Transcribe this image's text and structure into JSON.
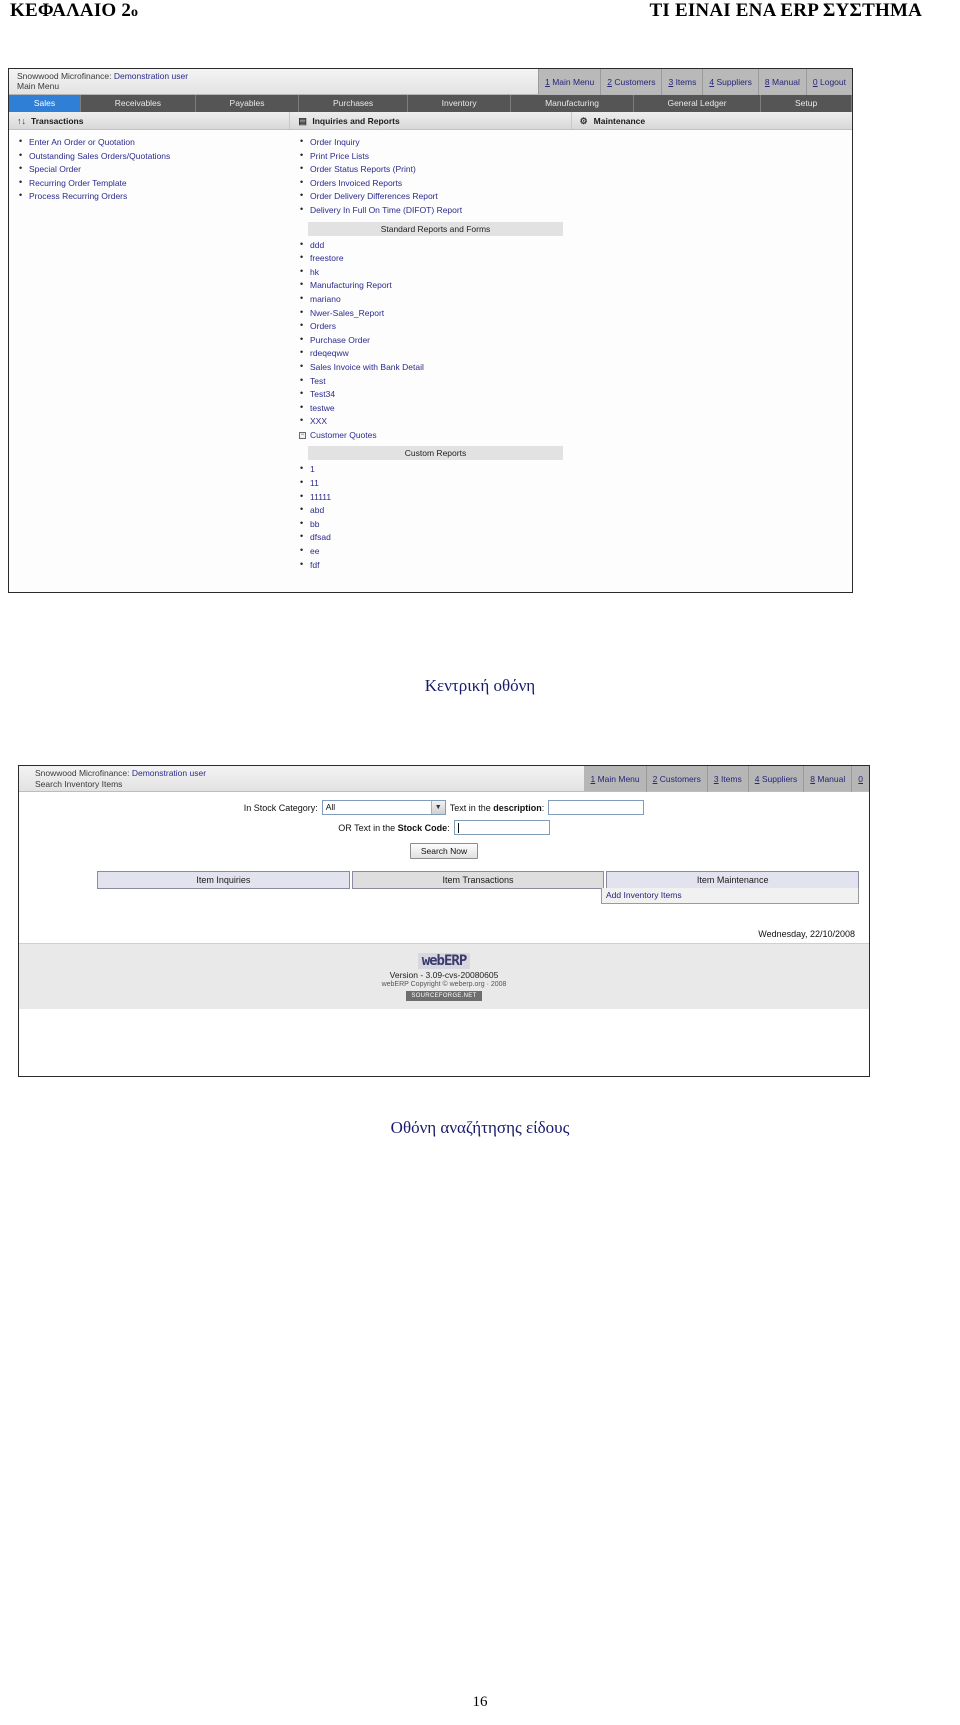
{
  "header": {
    "left_main": "ΚΕΦΑΛΑΙΟ 2",
    "left_sup": "ο",
    "right": "ΤΙ ΕΙΝΑΙ ΕΝΑ ERP ΣΥΣΤΗΜΑ"
  },
  "captions": {
    "first": "Κεντρική οθόνη",
    "second": "Οθόνη αναζήτησης είδους"
  },
  "page_number": "16",
  "screenshot_main_menu": {
    "identity_line1_prefix": "Snowwood Microfinance: ",
    "identity_line1_user": "Demonstration user",
    "identity_line2": "Main Menu",
    "nav_links": [
      {
        "key": "1",
        "label": " Main Menu"
      },
      {
        "key": "2",
        "label": " Customers"
      },
      {
        "key": "3",
        "label": " Items"
      },
      {
        "key": "4",
        "label": " Suppliers"
      },
      {
        "key": "8",
        "label": " Manual"
      },
      {
        "key": "0",
        "label": " Logout"
      }
    ],
    "tabs": [
      {
        "label": "Sales",
        "active": true
      },
      {
        "label": "Receivables",
        "active": false
      },
      {
        "label": "Payables",
        "active": false
      },
      {
        "label": "Purchases",
        "active": false
      },
      {
        "label": "Inventory",
        "active": false
      },
      {
        "label": "Manufacturing",
        "active": false
      },
      {
        "label": "General Ledger",
        "active": false
      },
      {
        "label": "Setup",
        "active": false
      }
    ],
    "sections": [
      {
        "icon": "updown-arrow-icon",
        "glyph": "↑↓",
        "label": "Transactions"
      },
      {
        "icon": "chart-icon",
        "glyph": "▤",
        "label": "Inquiries and Reports"
      },
      {
        "icon": "gear-icon",
        "glyph": "⚙",
        "label": "Maintenance"
      }
    ],
    "transactions": [
      "Enter An Order or Quotation",
      "Outstanding Sales Orders/Quotations",
      "Special Order",
      "Recurring Order Template",
      "Process Recurring Orders"
    ],
    "inquiries": [
      "Order Inquiry",
      "Print Price Lists",
      "Order Status Reports (Print)",
      "Orders Invoiced Reports",
      "Order Delivery Differences Report",
      "Delivery In Full On Time (DIFOT) Report"
    ],
    "standard_reports_heading": "Standard Reports and Forms",
    "standard_reports": [
      "ddd",
      "freestore",
      "hk",
      "Manufacturing Report",
      "mariano",
      "Nwer-Sales_Report",
      "Orders",
      "Purchase Order",
      "rdeqeqww",
      "Sales Invoice with Bank Detail",
      "Test",
      "Test34",
      "testwe",
      "XXX"
    ],
    "collapsible_item": "Customer Quotes",
    "custom_reports_heading": "Custom Reports",
    "custom_reports": [
      "1",
      "11",
      "11111",
      "abd",
      "bb",
      "dfsad",
      "ee",
      "fdf"
    ]
  },
  "screenshot_search_items": {
    "identity_line1_prefix": "Snowwood Microfinance: ",
    "identity_line1_user": "Demonstration user",
    "identity_line2": "Search Inventory Items",
    "nav_links": [
      {
        "key": "1",
        "label": " Main Menu"
      },
      {
        "key": "2",
        "label": " Customers"
      },
      {
        "key": "3",
        "label": " Items"
      },
      {
        "key": "4",
        "label": " Suppliers"
      },
      {
        "key": "8",
        "label": " Manual"
      },
      {
        "key": "0",
        "label": ""
      }
    ],
    "form": {
      "category_label": "In Stock Category:",
      "category_value": "All",
      "description_label_pre": "Text in the ",
      "description_label_bold": "description",
      "description_label_post": ":",
      "description_value": "",
      "stockcode_label_pre": "OR Text in the ",
      "stockcode_label_bold": "Stock Code",
      "stockcode_label_post": ":",
      "stockcode_value": "",
      "search_button": "Search Now"
    },
    "tabs": [
      "Item Inquiries",
      "Item Transactions",
      "Item Maintenance"
    ],
    "submenu_item": "Add Inventory Items",
    "date": "Wednesday, 22/10/2008",
    "footer": {
      "logo": "webERP",
      "version": "Version - 3.09-cvs-20080605",
      "copyright": "webERP Copyright © weberp.org · 2008",
      "badge": "SOURCEFORGE.NET"
    }
  }
}
